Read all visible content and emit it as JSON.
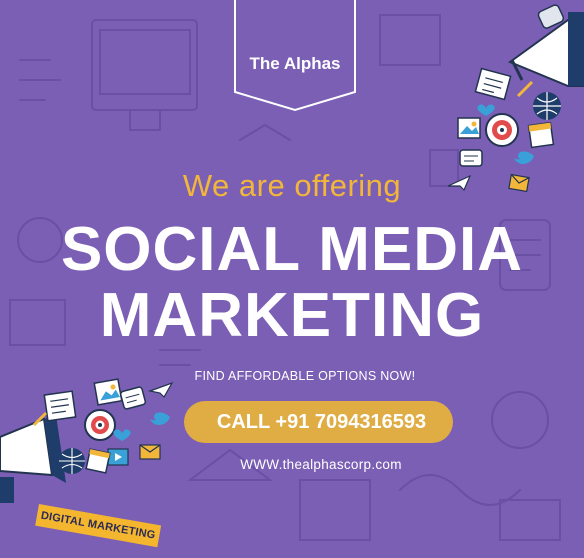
{
  "brand": {
    "name": "The Alphas"
  },
  "hero": {
    "intro": "We are offering",
    "headline_line1": "SOCIAL MEDIA",
    "headline_line2": "MARKETING",
    "subtext": "FIND AFFORDABLE OPTIONS NOW!"
  },
  "cta": {
    "label": "CALL +91 7094316593"
  },
  "website": "WWW.thealphascorp.com",
  "badge": {
    "label": "DIGITAL MARKETING"
  },
  "colors": {
    "background": "#7a5fb5",
    "accent_gold": "#e0ac44",
    "text_white": "#ffffff"
  }
}
